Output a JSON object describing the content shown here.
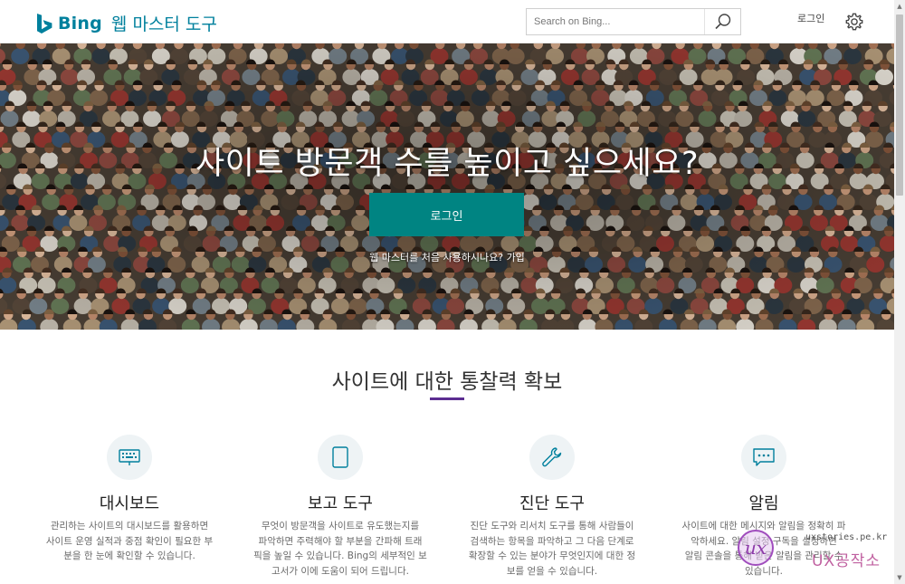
{
  "header": {
    "logo_word": "Bing",
    "logo_title": "웹 마스터 도구",
    "search_placeholder": "Search on Bing...",
    "signin_label": "로그인",
    "settings_icon": "gear-icon",
    "search_icon": "search-icon"
  },
  "hero": {
    "title": "사이트 방문객 수를 높이고 싶으세요?",
    "button_label": "로그인",
    "subtitle_prefix": "웹 마스터를 처음 사용하시나요?",
    "subtitle_link": "가입"
  },
  "features": {
    "section_title": "사이트에 대한 통찰력 확보",
    "accent_color": "#5c2d91",
    "items": [
      {
        "icon": "keyboard-icon",
        "title": "대시보드",
        "lines": [
          "관리하는 사이트의 대시보드를 활용하면",
          "사이트 운영 실적과 중점 확인이 필요한 부",
          "분을 한 눈에 확인할 수 있습니다."
        ]
      },
      {
        "icon": "tablet-icon",
        "title": "보고 도구",
        "lines": [
          "무엇이 방문객을 사이트로 유도했는지를",
          "파악하면 주력해야 할 부분을 간파해 트래",
          "픽을 높일 수 있습니다. Bing의 세부적인 보",
          "고서가 이에 도움이 되어 드립니다."
        ]
      },
      {
        "icon": "wrench-icon",
        "title": "진단 도구",
        "lines": [
          "진단 도구와 리서치 도구를 통해 사람들이",
          "검색하는 항목을 파악하고 그 다음 단계로",
          "확장할 수 있는 분야가 무엇인지에 대한 정",
          "보를 얻을 수 있습니다."
        ]
      },
      {
        "icon": "message-icon",
        "title": "알림",
        "lines": [
          "사이트에 대한 메시지와 알림을 정확히 파",
          "악하세요. 알림 설정 구독을 설정하면",
          "알림 콘솔을 통해 받은 알림을 관리할 수",
          "있습니다."
        ]
      }
    ]
  },
  "watermark": {
    "logo_letter": "ux",
    "url": "uxstories.pe.kr",
    "brand": "UX공작소"
  },
  "colors": {
    "brand_teal": "#00809d",
    "button_teal": "#008482"
  }
}
